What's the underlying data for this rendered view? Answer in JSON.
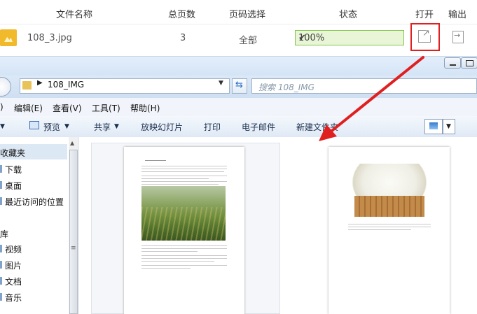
{
  "converter": {
    "headers": {
      "file_name": "文件名称",
      "total_pages": "总页数",
      "page_select": "页码选择",
      "status": "状态",
      "open": "打开",
      "export": "输出"
    },
    "row": {
      "file_name": "108_3.jpg",
      "total_pages": "3",
      "page_select": "全部",
      "status_text": "100%",
      "progress": 1.0
    },
    "icons": [
      "image-file-icon",
      "check-icon",
      "open-external-icon",
      "export-icon"
    ],
    "highlight_color": "#e02020"
  },
  "explorer": {
    "address": {
      "path": "108_IMG",
      "search_placeholder": "搜索 108_IMG"
    },
    "menu": [
      "编辑(E)",
      "查看(V)",
      "工具(T)",
      "帮助(H)"
    ],
    "menu_partial": ")",
    "toolbar": {
      "preview": "预览",
      "share": "共享",
      "slideshow": "放映幻灯片",
      "print": "打印",
      "email": "电子邮件",
      "new_folder": "新建文件夹"
    },
    "nav": {
      "favorites": "收藏夹",
      "downloads": "下载",
      "desktop": "桌面",
      "recent": "最近访问的位置",
      "libraries": "库",
      "videos": "视频",
      "pictures": "图片",
      "documents": "文档",
      "music": "音乐"
    }
  }
}
